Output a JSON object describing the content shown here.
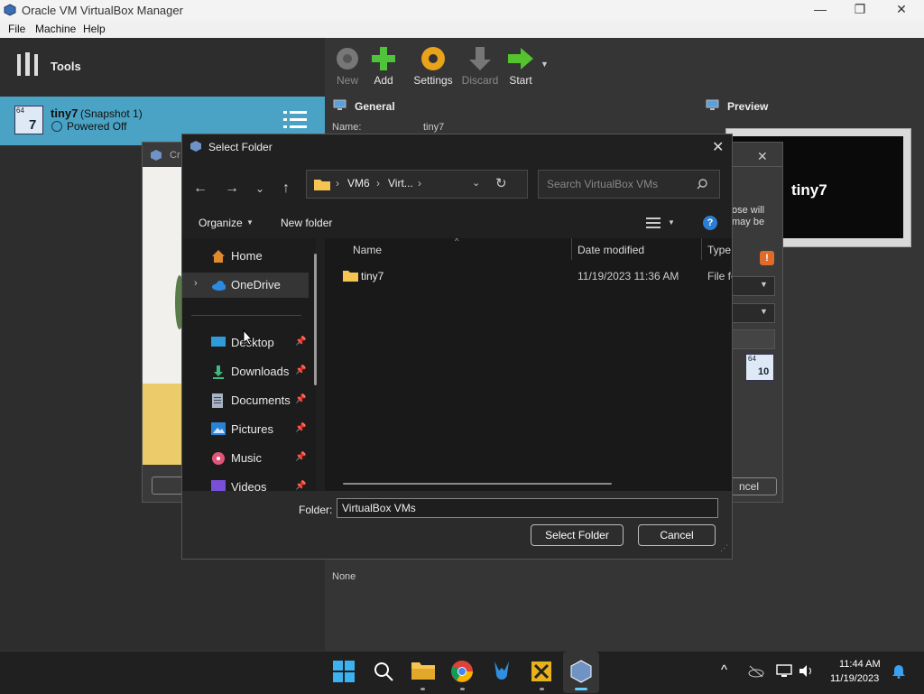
{
  "window": {
    "title": "Oracle VM VirtualBox Manager"
  },
  "menubar": {
    "file": "File",
    "machine": "Machine",
    "help": "Help"
  },
  "sidebar": {
    "tools_label": "Tools",
    "vm": {
      "name": "tiny7",
      "snapshot": "(Snapshot 1)",
      "state": "Powered Off",
      "os_badge": "64",
      "os_num": "7"
    }
  },
  "toolbar": {
    "new": "New",
    "add": "Add",
    "settings": "Settings",
    "discard": "Discard",
    "start": "Start"
  },
  "details": {
    "general_title": "General",
    "name_label": "Name:",
    "name_value": "tiny7",
    "preview_title": "Preview",
    "preview_vm_name": "tiny7",
    "description_value": "None"
  },
  "bg_wizard": {
    "text_partial": "ose will\nmay be",
    "cancel_partial": "ncel",
    "os_badge_num": "10"
  },
  "dialog": {
    "title": "Select Folder",
    "address": {
      "seg1": "VM6",
      "seg2": "Virt..."
    },
    "search_placeholder": "Search VirtualBox VMs",
    "organize": "Organize",
    "new_folder": "New folder",
    "nav": [
      {
        "label": "Home",
        "icon": "home-icon"
      },
      {
        "label": "OneDrive",
        "icon": "cloud-icon"
      },
      {
        "label": "Desktop",
        "icon": "desktop-icon"
      },
      {
        "label": "Downloads",
        "icon": "download-icon"
      },
      {
        "label": "Documents",
        "icon": "document-icon"
      },
      {
        "label": "Pictures",
        "icon": "pictures-icon"
      },
      {
        "label": "Music",
        "icon": "music-icon"
      },
      {
        "label": "Videos",
        "icon": "videos-icon"
      }
    ],
    "columns": {
      "name": "Name",
      "date": "Date modified",
      "type": "Type"
    },
    "files": [
      {
        "name": "tiny7",
        "date": "11/19/2023 11:36 AM",
        "type": "File fo"
      }
    ],
    "folder_label": "Folder:",
    "folder_value": "VirtualBox VMs",
    "select_button": "Select Folder",
    "cancel_button": "Cancel"
  },
  "taskbar": {
    "time": "11:44 AM",
    "date": "11/19/2023"
  },
  "colors": {
    "accent": "#4aa3c4",
    "help_blue": "#2a7fd4",
    "folder_yellow": "#f5c451"
  }
}
